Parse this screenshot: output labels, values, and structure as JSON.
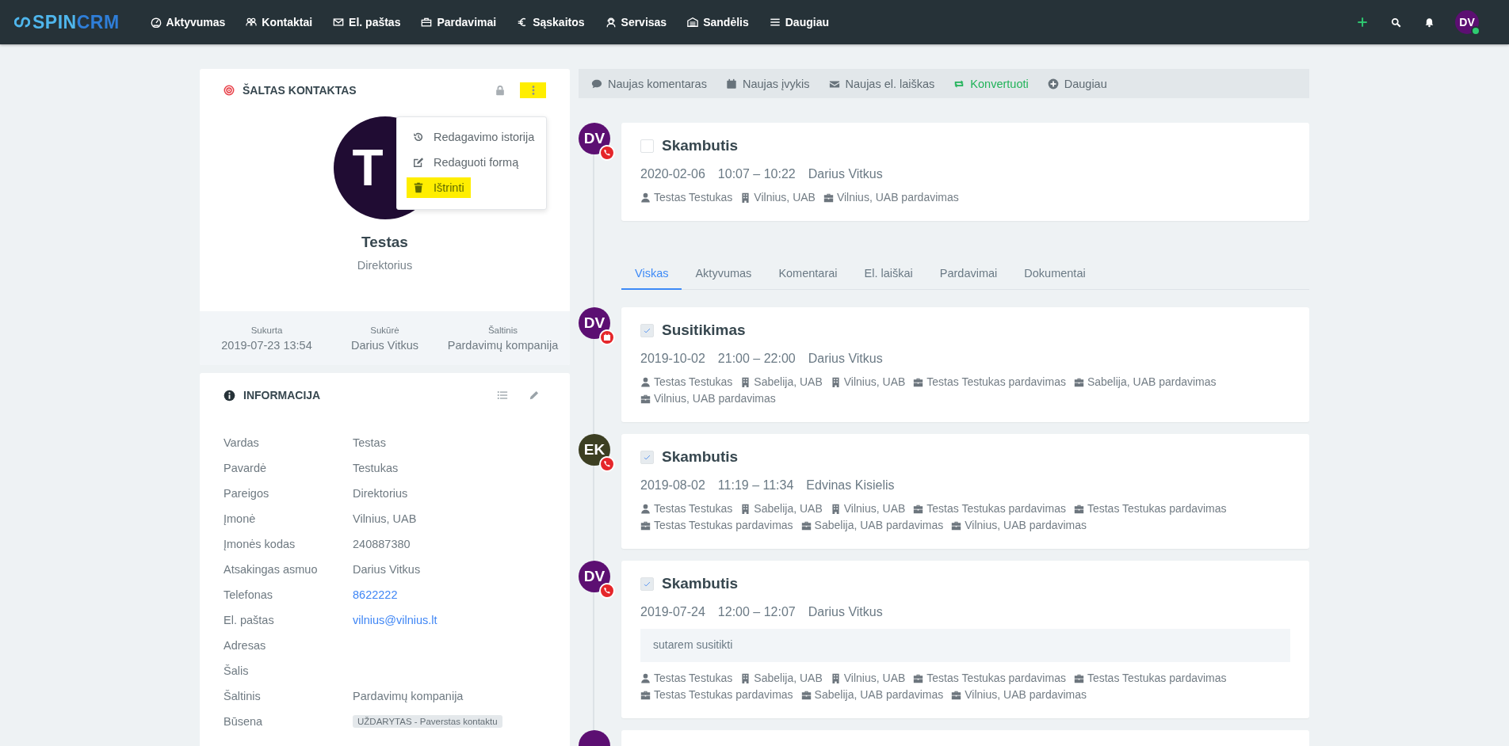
{
  "nav": {
    "logo": {
      "text_1": "SPIN",
      "text_2": "CRM"
    },
    "items": [
      {
        "label": "Aktyvumas"
      },
      {
        "label": "Kontaktai"
      },
      {
        "label": "El. paštas"
      },
      {
        "label": "Pardavimai"
      },
      {
        "label": "Sąskaitos"
      },
      {
        "label": "Servisas"
      },
      {
        "label": "Sandėlis"
      },
      {
        "label": "Daugiau"
      }
    ],
    "user": {
      "initials": "DV",
      "color": "#5c0f72",
      "online": true
    }
  },
  "contact": {
    "title": "ŠALTAS KONTAKTAS",
    "menu_highlighted": true,
    "avatar": "T",
    "name": "Testas",
    "position": "Direktorius",
    "menu": [
      {
        "label": "Redagavimo istorija",
        "highlighted": false
      },
      {
        "label": "Redaguoti formą",
        "highlighted": false
      },
      {
        "label": "Ištrinti",
        "highlighted": true
      }
    ],
    "stats": [
      {
        "label": "Sukurta",
        "value": "2019-07-23 13:54"
      },
      {
        "label": "Sukūrė",
        "value": "Darius Vitkus"
      },
      {
        "label": "Šaltinis",
        "value": "Pardavimų kompanija"
      }
    ]
  },
  "info": {
    "title": "INFORMACIJA",
    "fields": [
      {
        "label": "Vardas",
        "value": "Testas",
        "kind": "text"
      },
      {
        "label": "Pavardė",
        "value": "Testukas",
        "kind": "text"
      },
      {
        "label": "Pareigos",
        "value": "Direktorius",
        "kind": "text"
      },
      {
        "label": "Įmonė",
        "value": "Vilnius, UAB",
        "kind": "text"
      },
      {
        "label": "Įmonės kodas",
        "value": "240887380",
        "kind": "text"
      },
      {
        "label": "Atsakingas asmuo",
        "value": "Darius Vitkus",
        "kind": "text"
      },
      {
        "label": "Telefonas",
        "value": "8622222",
        "kind": "link"
      },
      {
        "label": "El. paštas",
        "value": "vilnius@vilnius.lt",
        "kind": "link"
      },
      {
        "label": "Adresas",
        "kind": "empty"
      },
      {
        "label": "Šalis",
        "kind": "empty"
      },
      {
        "label": "Šaltinis",
        "value": "Pardavimų kompanija",
        "kind": "text"
      },
      {
        "label": "Būsena",
        "value": "UŽDARYTAS - Paverstas kontaktu",
        "kind": "badge"
      }
    ]
  },
  "actions": [
    {
      "label": "Naujas komentaras",
      "kind": "normal"
    },
    {
      "label": "Naujas įvykis",
      "kind": "normal"
    },
    {
      "label": "Naujas el. laiškas",
      "kind": "normal"
    },
    {
      "label": "Konvertuoti",
      "kind": "accent"
    },
    {
      "label": "Daugiau",
      "kind": "normal"
    }
  ],
  "pinned": [
    {
      "initials": "DV",
      "color": "#5c0f72",
      "kind": "call",
      "checked": false,
      "title": "Skambutis",
      "date": "2020-02-06",
      "time": "10:07 – 10:22",
      "person": "Darius Vitkus",
      "tags": [
        {
          "kind": "person",
          "label": "Testas Testukas"
        },
        {
          "kind": "company",
          "label": "Vilnius, UAB"
        },
        {
          "kind": "deal",
          "label": "Vilnius, UAB pardavimas"
        }
      ]
    }
  ],
  "tabs": [
    {
      "label": "Viskas",
      "selected": true
    },
    {
      "label": "Aktyvumas",
      "selected": false
    },
    {
      "label": "Komentarai",
      "selected": false
    },
    {
      "label": "El. laiškai",
      "selected": false
    },
    {
      "label": "Pardavimai",
      "selected": false
    },
    {
      "label": "Dokumentai",
      "selected": false
    }
  ],
  "timeline": [
    {
      "initials": "DV",
      "color": "#5c0f72",
      "kind": "meeting",
      "checked": true,
      "title": "Susitikimas",
      "date": "2019-10-02",
      "time": "21:00 – 22:00",
      "person": "Darius Vitkus",
      "tags": [
        {
          "kind": "person",
          "label": "Testas Testukas"
        },
        {
          "kind": "company",
          "label": "Sabelija, UAB"
        },
        {
          "kind": "company",
          "label": "Vilnius, UAB"
        },
        {
          "kind": "deal",
          "label": "Testas Testukas pardavimas"
        },
        {
          "kind": "deal",
          "label": "Sabelija, UAB pardavimas"
        },
        {
          "kind": "deal",
          "label": "Vilnius, UAB pardavimas"
        }
      ]
    },
    {
      "initials": "EK",
      "color": "#3c3f22",
      "kind": "call",
      "checked": true,
      "title": "Skambutis",
      "date": "2019-08-02",
      "time": "11:19 – 11:34",
      "person": "Edvinas Kisielis",
      "tags": [
        {
          "kind": "person",
          "label": "Testas Testukas"
        },
        {
          "kind": "company",
          "label": "Sabelija, UAB"
        },
        {
          "kind": "company",
          "label": "Vilnius, UAB"
        },
        {
          "kind": "deal",
          "label": "Testas Testukas pardavimas"
        },
        {
          "kind": "deal",
          "label": "Testas Testukas pardavimas"
        },
        {
          "kind": "deal",
          "label": "Testas Testukas pardavimas"
        },
        {
          "kind": "deal",
          "label": "Sabelija, UAB pardavimas"
        },
        {
          "kind": "deal",
          "label": "Vilnius, UAB pardavimas"
        }
      ]
    },
    {
      "initials": "DV",
      "color": "#5c0f72",
      "kind": "call",
      "checked": true,
      "title": "Skambutis",
      "date": "2019-07-24",
      "time": "12:00 – 12:07",
      "person": "Darius Vitkus",
      "note": "sutarem susitikti",
      "tags": [
        {
          "kind": "person",
          "label": "Testas Testukas"
        },
        {
          "kind": "company",
          "label": "Sabelija, UAB"
        },
        {
          "kind": "company",
          "label": "Vilnius, UAB"
        },
        {
          "kind": "deal",
          "label": "Testas Testukas pardavimas"
        },
        {
          "kind": "deal",
          "label": "Testas Testukas pardavimas"
        },
        {
          "kind": "deal",
          "label": "Testas Testukas pardavimas"
        },
        {
          "kind": "deal",
          "label": "Sabelija, UAB pardavimas"
        },
        {
          "kind": "deal",
          "label": "Vilnius, UAB pardavimas"
        }
      ]
    },
    {
      "color": "#5c0f72"
    }
  ]
}
